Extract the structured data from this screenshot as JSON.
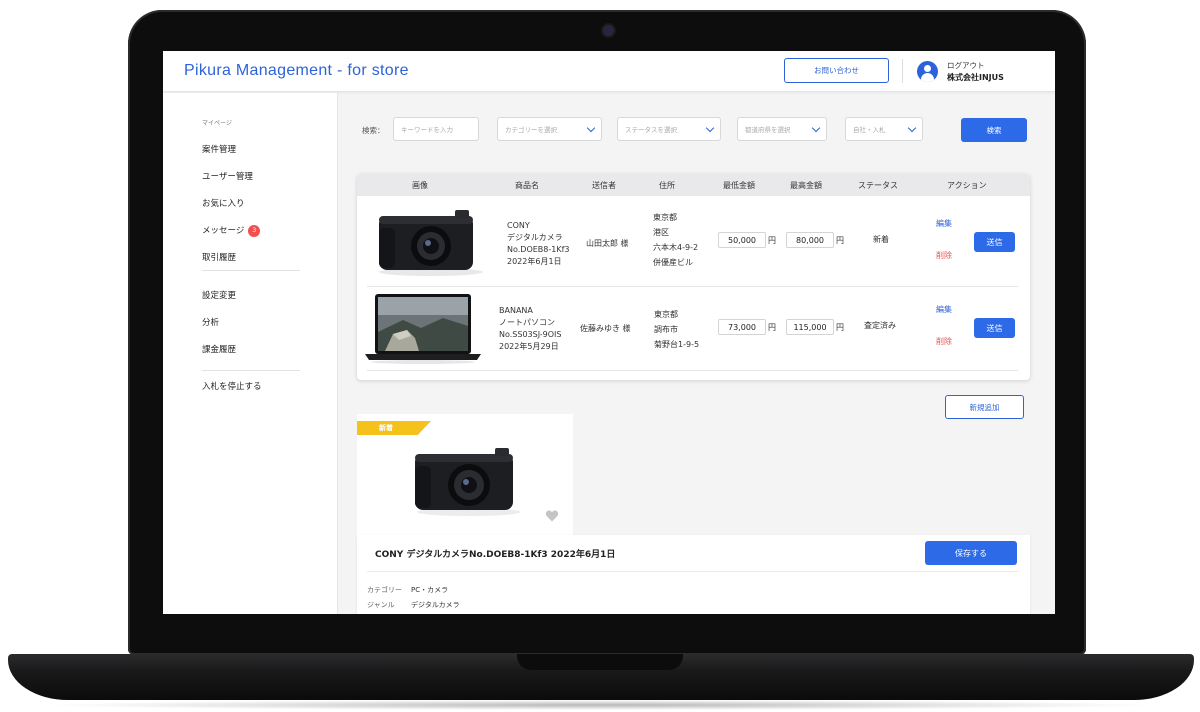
{
  "app": {
    "title": "Pikura Management - for store"
  },
  "header": {
    "contact_label": "お問い合わせ",
    "logout_label": "ログアウト",
    "company_name": "株式会社INJUS"
  },
  "sidebar": {
    "section_label": "マイページ",
    "items": [
      {
        "label": "案件管理"
      },
      {
        "label": "ユーザー管理"
      },
      {
        "label": "お気に入り"
      },
      {
        "label": "メッセージ",
        "badge": "3"
      },
      {
        "label": "取引履歴"
      },
      {
        "label": "設定変更"
      },
      {
        "label": "分析"
      },
      {
        "label": "課金履歴"
      },
      {
        "label": "入札を停止する"
      }
    ]
  },
  "search": {
    "label": "検索：",
    "keyword_placeholder": "キーワードを入力",
    "category_placeholder": "カテゴリーを選択",
    "status_placeholder": "ステータスを選択",
    "prefecture_placeholder": "都道府県を選択",
    "own_bid_placeholder": "自社・入札",
    "button_label": "検索"
  },
  "table": {
    "headers": [
      "画像",
      "商品名",
      "送信者",
      "住所",
      "最低金額",
      "最高金額",
      "ステータス",
      "アクション"
    ],
    "rows": [
      {
        "product": [
          "CONY",
          "デジタルカメラ",
          "No.DOEB8-1Kf3",
          "2022年6月1日"
        ],
        "sender": "山田太郎 様",
        "address": [
          "東京都",
          "港区",
          "六本木4-9-2",
          "併優産ビル"
        ],
        "min_price": "50,000",
        "max_price": "80,000",
        "unit": "円",
        "status": "新着",
        "edit_label": "編集",
        "delete_label": "削除",
        "send_label": "送信"
      },
      {
        "product": [
          "BANANA",
          "ノートパソコン",
          "No.SS03SJ-9OIS",
          "2022年5月29日"
        ],
        "sender": "佐藤みゆき 様",
        "address": [
          "東京都",
          "調布市",
          "菊野台1-9-5"
        ],
        "min_price": "73,000",
        "max_price": "115,000",
        "unit": "円",
        "status": "査定済み",
        "edit_label": "編集",
        "delete_label": "削除",
        "send_label": "送信"
      }
    ]
  },
  "new_add_label": "新規追加",
  "product_card": {
    "ribbon_label": "新着"
  },
  "detail": {
    "title": "CONY デジタルカメラNo.DOEB8-1Kf3 2022年6月1日",
    "save_label": "保存する",
    "attributes": [
      {
        "key": "カテゴリー",
        "value": "PC・カメラ"
      },
      {
        "key": "ジャンル",
        "value": "デジタルカメラ"
      }
    ]
  },
  "colors": {
    "accent": "#2d6ae8",
    "brand_text": "#2d63d8",
    "badge": "#f24f4f",
    "delete": "#e25555",
    "ribbon": "#f4c21a"
  }
}
